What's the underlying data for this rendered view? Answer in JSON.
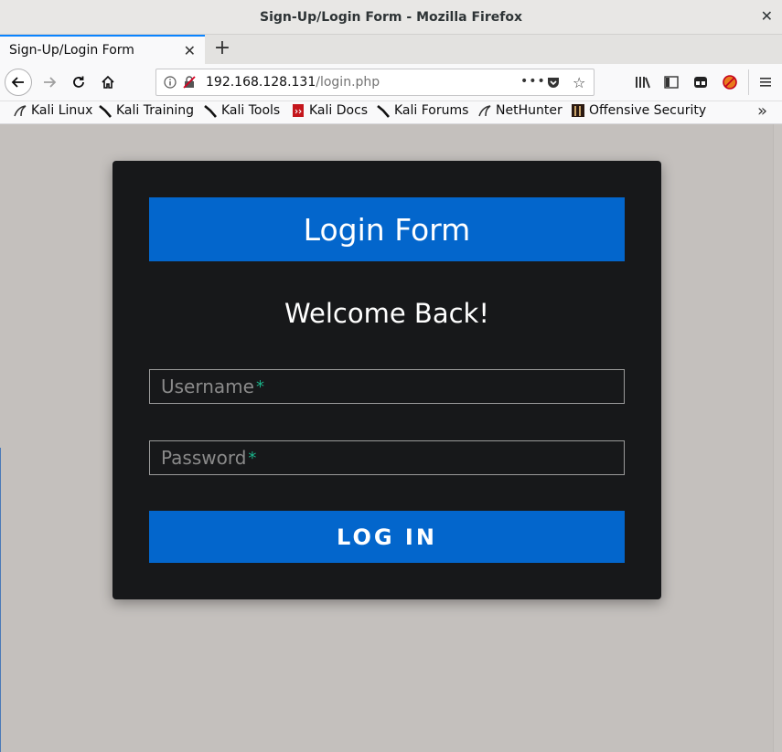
{
  "window": {
    "title": "Sign-Up/Login Form - Mozilla Firefox"
  },
  "tabs": [
    {
      "label": "Sign-Up/Login Form"
    }
  ],
  "urlbar": {
    "host": "192.168.128.131",
    "path": "/login.php"
  },
  "bookmarks": [
    {
      "label": "Kali Linux"
    },
    {
      "label": "Kali Training"
    },
    {
      "label": "Kali Tools"
    },
    {
      "label": "Kali Docs"
    },
    {
      "label": "Kali Forums"
    },
    {
      "label": "NetHunter"
    },
    {
      "label": "Offensive Security"
    }
  ],
  "form": {
    "header": "Login Form",
    "welcome": "Welcome Back!",
    "username_placeholder": "Username",
    "password_placeholder": "Password",
    "required_mark": "*",
    "submit_label": "LOG IN"
  },
  "colors": {
    "accent": "#0366cc",
    "card_bg": "#17181a",
    "page_bg": "#c4c0bd",
    "required": "#1ab188"
  }
}
